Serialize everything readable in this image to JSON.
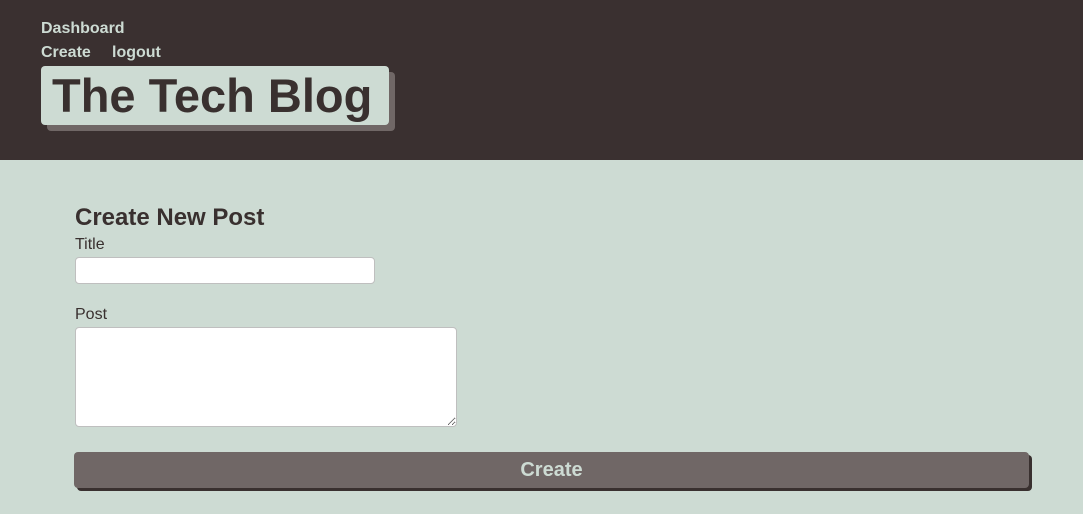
{
  "nav": {
    "dashboard": "Dashboard",
    "create": "Create",
    "logout": "logout"
  },
  "header": {
    "title": "The Tech Blog"
  },
  "form": {
    "heading": "Create New Post",
    "title_label": "Title",
    "title_value": "",
    "title_placeholder": "",
    "post_label": "Post",
    "post_value": "",
    "post_placeholder": "",
    "submit_label": "Create"
  },
  "colors": {
    "header_bg": "#3a3030",
    "page_bg": "#cddbd3",
    "text_dark": "#39302f",
    "button_bg": "#706766",
    "button_text": "#cddbd3"
  }
}
